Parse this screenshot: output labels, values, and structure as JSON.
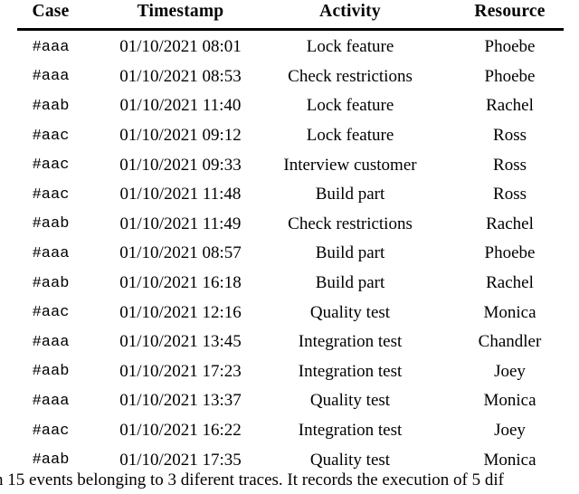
{
  "table": {
    "columns": [
      {
        "key": "case",
        "label": "Case"
      },
      {
        "key": "timestamp",
        "label": "Timestamp"
      },
      {
        "key": "activity",
        "label": "Activity"
      },
      {
        "key": "resource",
        "label": "Resource"
      }
    ],
    "rows": [
      {
        "case": "#aaa",
        "timestamp": "01/10/2021 08:01",
        "activity": "Lock feature",
        "resource": "Phoebe"
      },
      {
        "case": "#aaa",
        "timestamp": "01/10/2021 08:53",
        "activity": "Check restrictions",
        "resource": "Phoebe"
      },
      {
        "case": "#aab",
        "timestamp": "01/10/2021 11:40",
        "activity": "Lock feature",
        "resource": "Rachel"
      },
      {
        "case": "#aac",
        "timestamp": "01/10/2021 09:12",
        "activity": "Lock feature",
        "resource": "Ross"
      },
      {
        "case": "#aac",
        "timestamp": "01/10/2021 09:33",
        "activity": "Interview customer",
        "resource": "Ross"
      },
      {
        "case": "#aac",
        "timestamp": "01/10/2021 11:48",
        "activity": "Build part",
        "resource": "Ross"
      },
      {
        "case": "#aab",
        "timestamp": "01/10/2021 11:49",
        "activity": "Check restrictions",
        "resource": "Rachel"
      },
      {
        "case": "#aaa",
        "timestamp": "01/10/2021 08:57",
        "activity": "Build part",
        "resource": "Phoebe"
      },
      {
        "case": "#aab",
        "timestamp": "01/10/2021 16:18",
        "activity": "Build part",
        "resource": "Rachel"
      },
      {
        "case": "#aac",
        "timestamp": "01/10/2021 12:16",
        "activity": "Quality test",
        "resource": "Monica"
      },
      {
        "case": "#aaa",
        "timestamp": "01/10/2021 13:45",
        "activity": "Integration test",
        "resource": "Chandler"
      },
      {
        "case": "#aab",
        "timestamp": "01/10/2021 17:23",
        "activity": "Integration test",
        "resource": "Joey"
      },
      {
        "case": "#aaa",
        "timestamp": "01/10/2021 13:37",
        "activity": "Quality test",
        "resource": "Monica"
      },
      {
        "case": "#aac",
        "timestamp": "01/10/2021 16:22",
        "activity": "Integration test",
        "resource": "Joey"
      },
      {
        "case": "#aab",
        "timestamp": "01/10/2021 17:35",
        "activity": "Quality test",
        "resource": "Monica"
      }
    ]
  },
  "caption": {
    "text": "n 15 events belonging to 3 diferent traces. It records the execution of 5 dif"
  }
}
